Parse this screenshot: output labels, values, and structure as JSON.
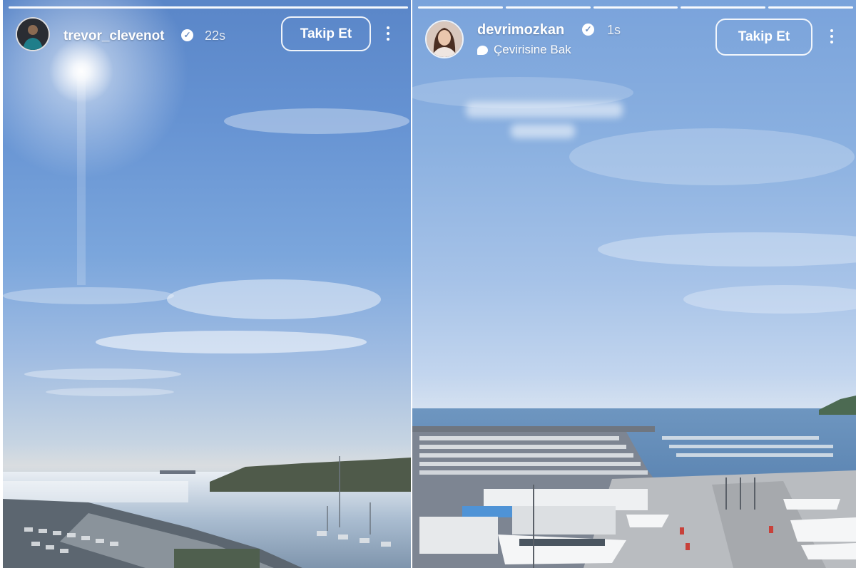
{
  "stories": [
    {
      "username": "trevor_clevenot",
      "time": "22s",
      "follow_label": "Takip Et",
      "progress_segments": 1,
      "verified_icon": "verified-badge-icon",
      "menu_icon": "more-vertical-icon",
      "scene": "sunny sky over bay with marina"
    },
    {
      "username": "devrimozkan",
      "time": "1s",
      "follow_label": "Takip Et",
      "translate_label": "Çevirisine Bak",
      "progress_segments": 5,
      "verified_icon": "verified-badge-icon",
      "menu_icon": "more-vertical-icon",
      "scene": "blue sky over sea and boat marina"
    }
  ],
  "colors": {
    "sky_left": "#6592d2",
    "sky_right": "#8ab0e0",
    "text": "#ffffff"
  }
}
